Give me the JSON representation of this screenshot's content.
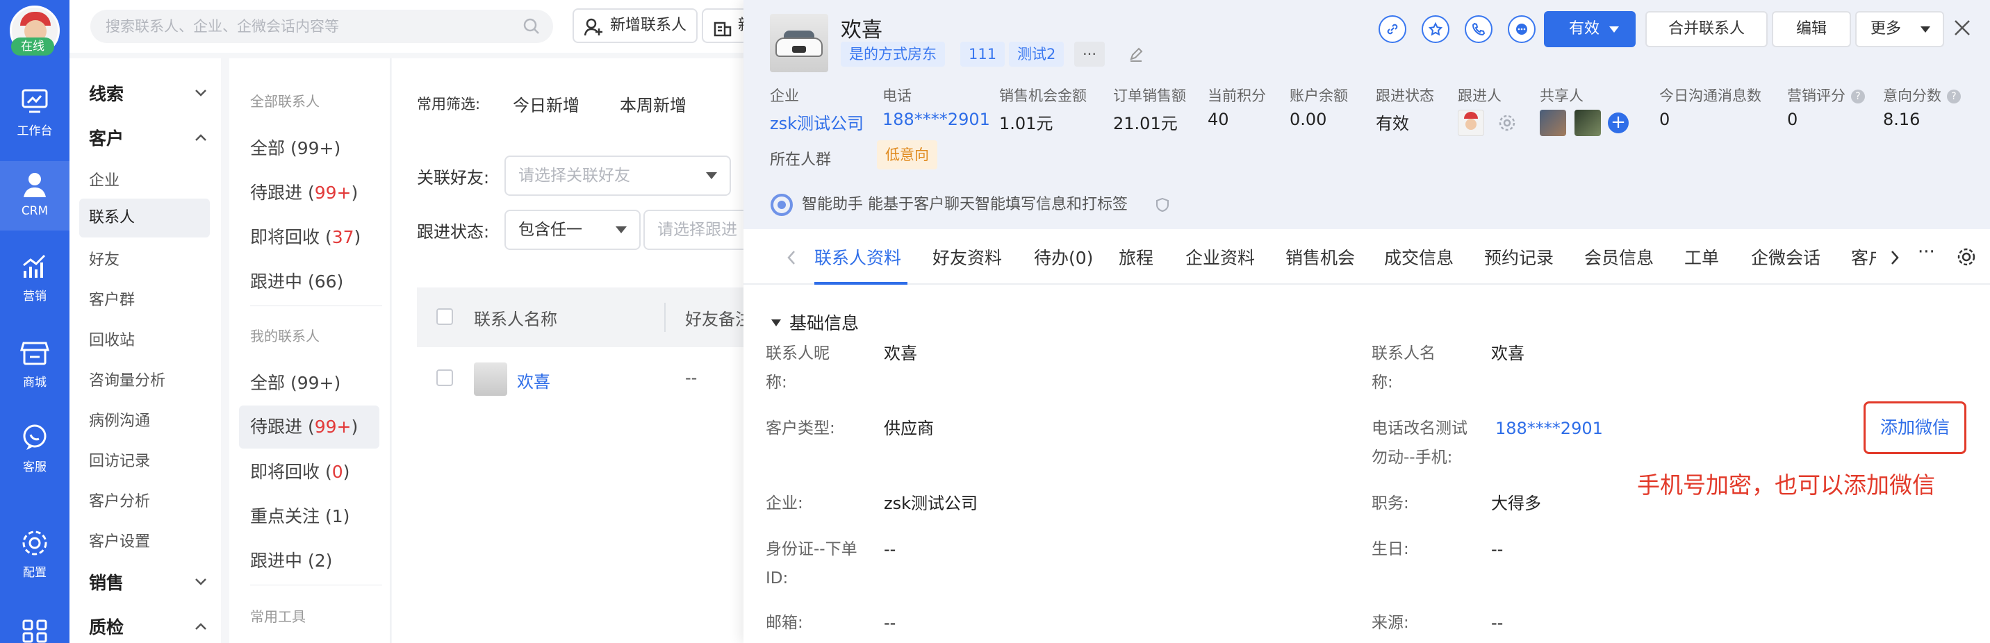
{
  "rail": {
    "status": "在线",
    "items": [
      {
        "label": "工作台",
        "icon": "monitor-icon"
      },
      {
        "label": "CRM",
        "icon": "user-icon"
      },
      {
        "label": "营销",
        "icon": "chart-icon"
      },
      {
        "label": "商城",
        "icon": "store-icon"
      },
      {
        "label": "客服",
        "icon": "chat-icon"
      },
      {
        "label": "配置",
        "icon": "gear-icon"
      }
    ]
  },
  "topbar": {
    "search_placeholder": "搜索联系人、企业、企微会话内容等",
    "add_contact": "新增联系人",
    "second_btn": "新"
  },
  "menu": {
    "group_clue": "线索",
    "group_customer": "客户",
    "items": [
      "企业",
      "联系人",
      "好友",
      "客户群",
      "回收站",
      "咨询量分析",
      "病例沟通",
      "回访记录",
      "客户分析",
      "客户设置"
    ],
    "group_sales": "销售",
    "group_qc": "质检"
  },
  "views": {
    "all_title": "全部联系人",
    "all_items": [
      {
        "label": "全部 (99+)",
        "pre": "",
        "count": "",
        "post": ""
      },
      {
        "label": "",
        "pre": "待跟进 (",
        "count": "99+",
        "post": ")"
      },
      {
        "label": "",
        "pre": "即将回收 (",
        "count": "37",
        "post": ")"
      },
      {
        "label": "跟进中 (66)",
        "pre": "",
        "count": "",
        "post": ""
      }
    ],
    "mine_title": "我的联系人",
    "mine_items": [
      {
        "label": "全部 (99+)",
        "pre": "",
        "count": "",
        "post": ""
      },
      {
        "label": "",
        "pre": "待跟进 (",
        "count": "99+",
        "post": ")"
      },
      {
        "label": "",
        "pre": "即将回收 (",
        "count": "0",
        "post": ")"
      },
      {
        "label": "重点关注 (1)",
        "pre": "",
        "count": "",
        "post": ""
      },
      {
        "label": "跟进中 (2)",
        "pre": "",
        "count": "",
        "post": ""
      }
    ],
    "tools_title": "常用工具"
  },
  "main": {
    "filters_label": "常用筛选:",
    "filter_today": "今日新增",
    "filter_week": "本周新增",
    "friend_label": "关联好友:",
    "friend_placeholder": "请选择关联好友",
    "follow_label": "跟进状态:",
    "follow_mode": "包含任一",
    "follow_placeholder": "请选择跟进",
    "col_name": "联系人名称",
    "col_remark": "好友备注",
    "row_name": "欢喜",
    "row_remark": "--"
  },
  "drawer": {
    "name": "欢喜",
    "tags": [
      "是的方式房东",
      "111",
      "测试2",
      "···"
    ],
    "status_btn": "有效",
    "merge_btn": "合并联系人",
    "edit_btn": "编辑",
    "more_btn": "更多",
    "stats": [
      {
        "label": "企业",
        "value": "zsk测试公司"
      },
      {
        "label": "电话",
        "value": "188****2901"
      },
      {
        "label": "销售机会金额",
        "value": "1.01元"
      },
      {
        "label": "订单销售额",
        "value": "21.01元"
      },
      {
        "label": "当前积分",
        "value": "40"
      },
      {
        "label": "账户余额",
        "value": "0.00"
      },
      {
        "label": "跟进状态",
        "value": "有效"
      },
      {
        "label": "跟进人",
        "value": ""
      },
      {
        "label": "共享人",
        "value": ""
      },
      {
        "label": "今日沟通消息数",
        "value": "0"
      },
      {
        "label": "营销评分",
        "value": "0"
      },
      {
        "label": "意向分数",
        "value": "8.16"
      }
    ],
    "group_label": "所在人群",
    "group_tag": "低意向",
    "assistant": "智能助手 能基于客户聊天智能填写信息和打标签",
    "tabs": [
      "联系人资料",
      "好友资料",
      "待办(0)",
      "旅程",
      "企业资料",
      "销售机会",
      "成交信息",
      "预约记录",
      "会员信息",
      "工单",
      "企微会话",
      "客户"
    ],
    "section_title": "基础信息",
    "fields": {
      "nick_label_1": "联系人昵",
      "nick_label_2": "称:",
      "nick_value": "欢喜",
      "cname_label_1": "联系人名",
      "cname_label_2": "称:",
      "cname_value": "欢喜",
      "ctype_label": "客户类型:",
      "ctype_value": "供应商",
      "phone_label_1": "电话改名测试",
      "phone_label_2": "勿动--手机:",
      "phone_value": "188****2901",
      "company_label": "企业:",
      "company_value": "zsk测试公司",
      "job_label": "职务:",
      "job_value": "大得多",
      "idcard_label_1": "身份证--下单",
      "idcard_label_2": "ID:",
      "idcard_value": "--",
      "birthday_label": "生日:",
      "birthday_value": "--",
      "email_label": "邮箱:",
      "email_value": "--",
      "source_label": "来源:",
      "source_value": "--"
    },
    "add_wechat": "添加微信",
    "annotation": "手机号加密，也可以添加微信"
  },
  "colors": {
    "brand": "#2f66e6",
    "link": "#2f6ee8",
    "danger": "#e23a2a",
    "warn": "#e08a1e"
  }
}
